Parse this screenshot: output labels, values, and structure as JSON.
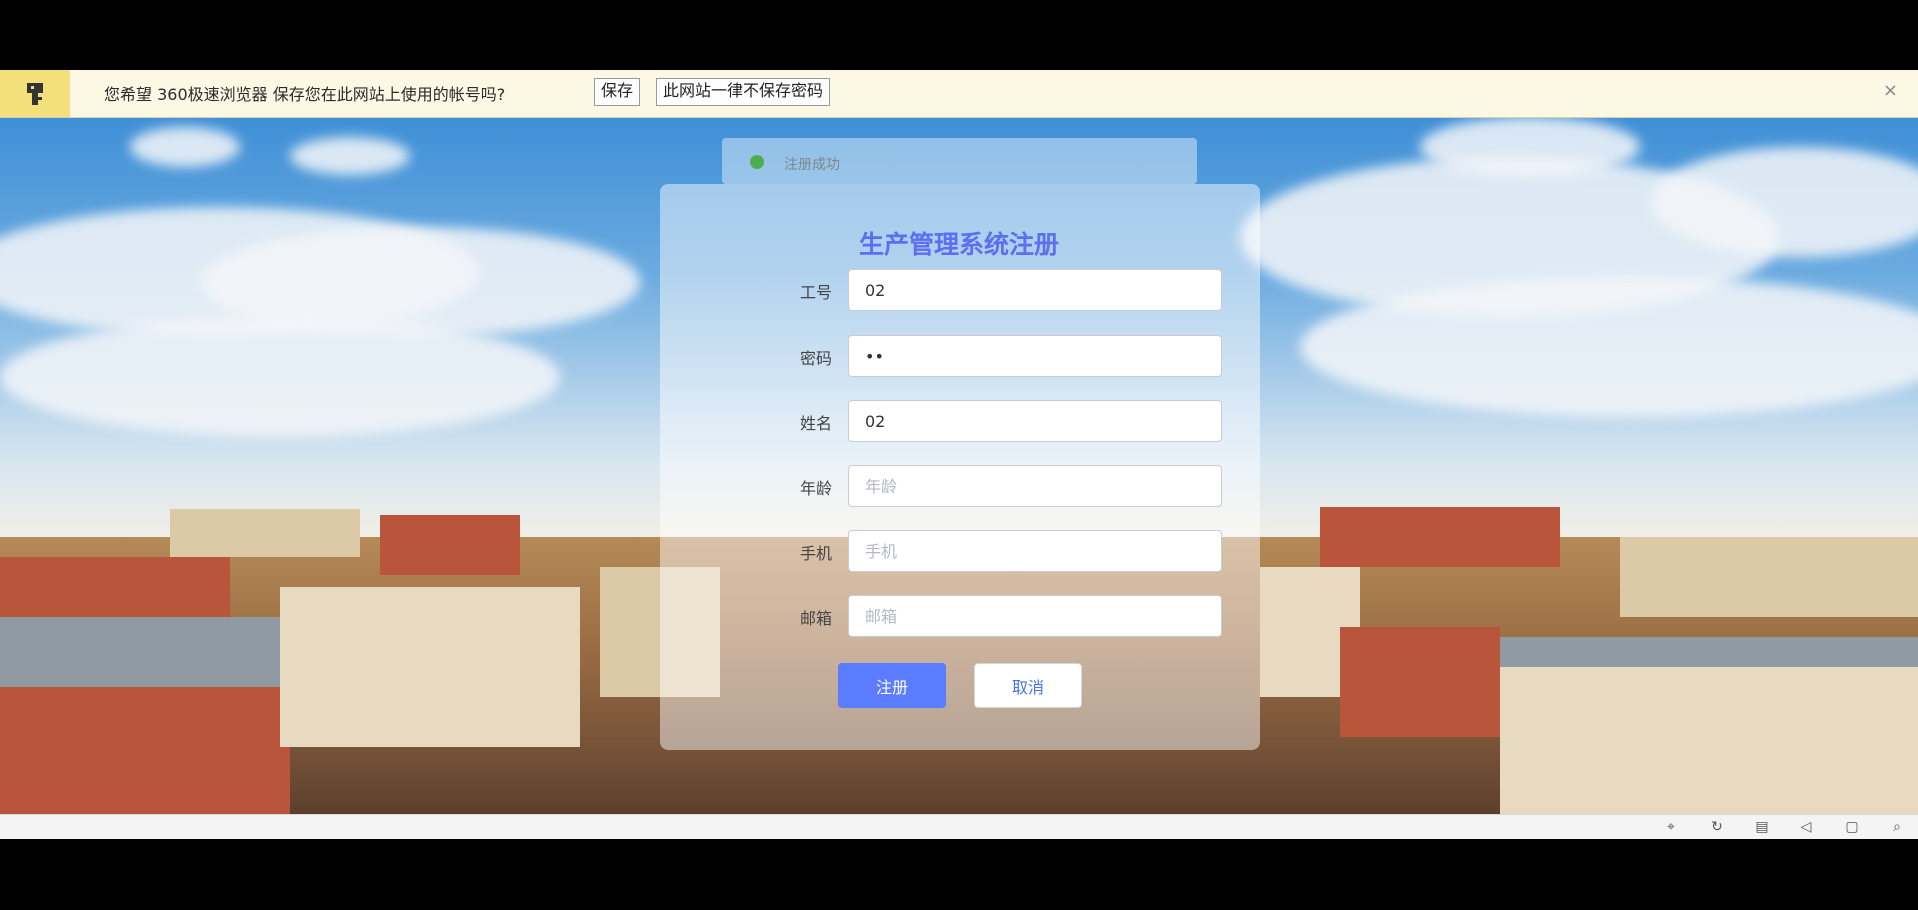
{
  "password_bar": {
    "message": "您希望 360极速浏览器 保存您在此网站上使用的帐号吗?",
    "save_label": "保存",
    "never_label": "此网站一律不保存密码",
    "close_label": "×"
  },
  "ghost_tab": {
    "text": "注册成功"
  },
  "form": {
    "title": "生产管理系统注册",
    "fields": [
      {
        "label": "工号",
        "value": "02",
        "placeholder": ""
      },
      {
        "label": "密码",
        "value": "••",
        "placeholder": ""
      },
      {
        "label": "姓名",
        "value": "02",
        "placeholder": ""
      },
      {
        "label": "年龄",
        "value": "",
        "placeholder": "年龄"
      },
      {
        "label": "手机",
        "value": "",
        "placeholder": "手机"
      },
      {
        "label": "邮箱",
        "value": "",
        "placeholder": "邮箱"
      }
    ],
    "register_label": "注册",
    "cancel_label": "取消"
  },
  "colors": {
    "accent": "#5b7cff",
    "title": "#5b6ff0",
    "password_bar": "#fdf8e4"
  },
  "taskbar": {
    "icons": [
      "pin-icon",
      "refresh-icon",
      "trash-icon",
      "speaker-icon",
      "window-icon",
      "search-icon"
    ]
  }
}
